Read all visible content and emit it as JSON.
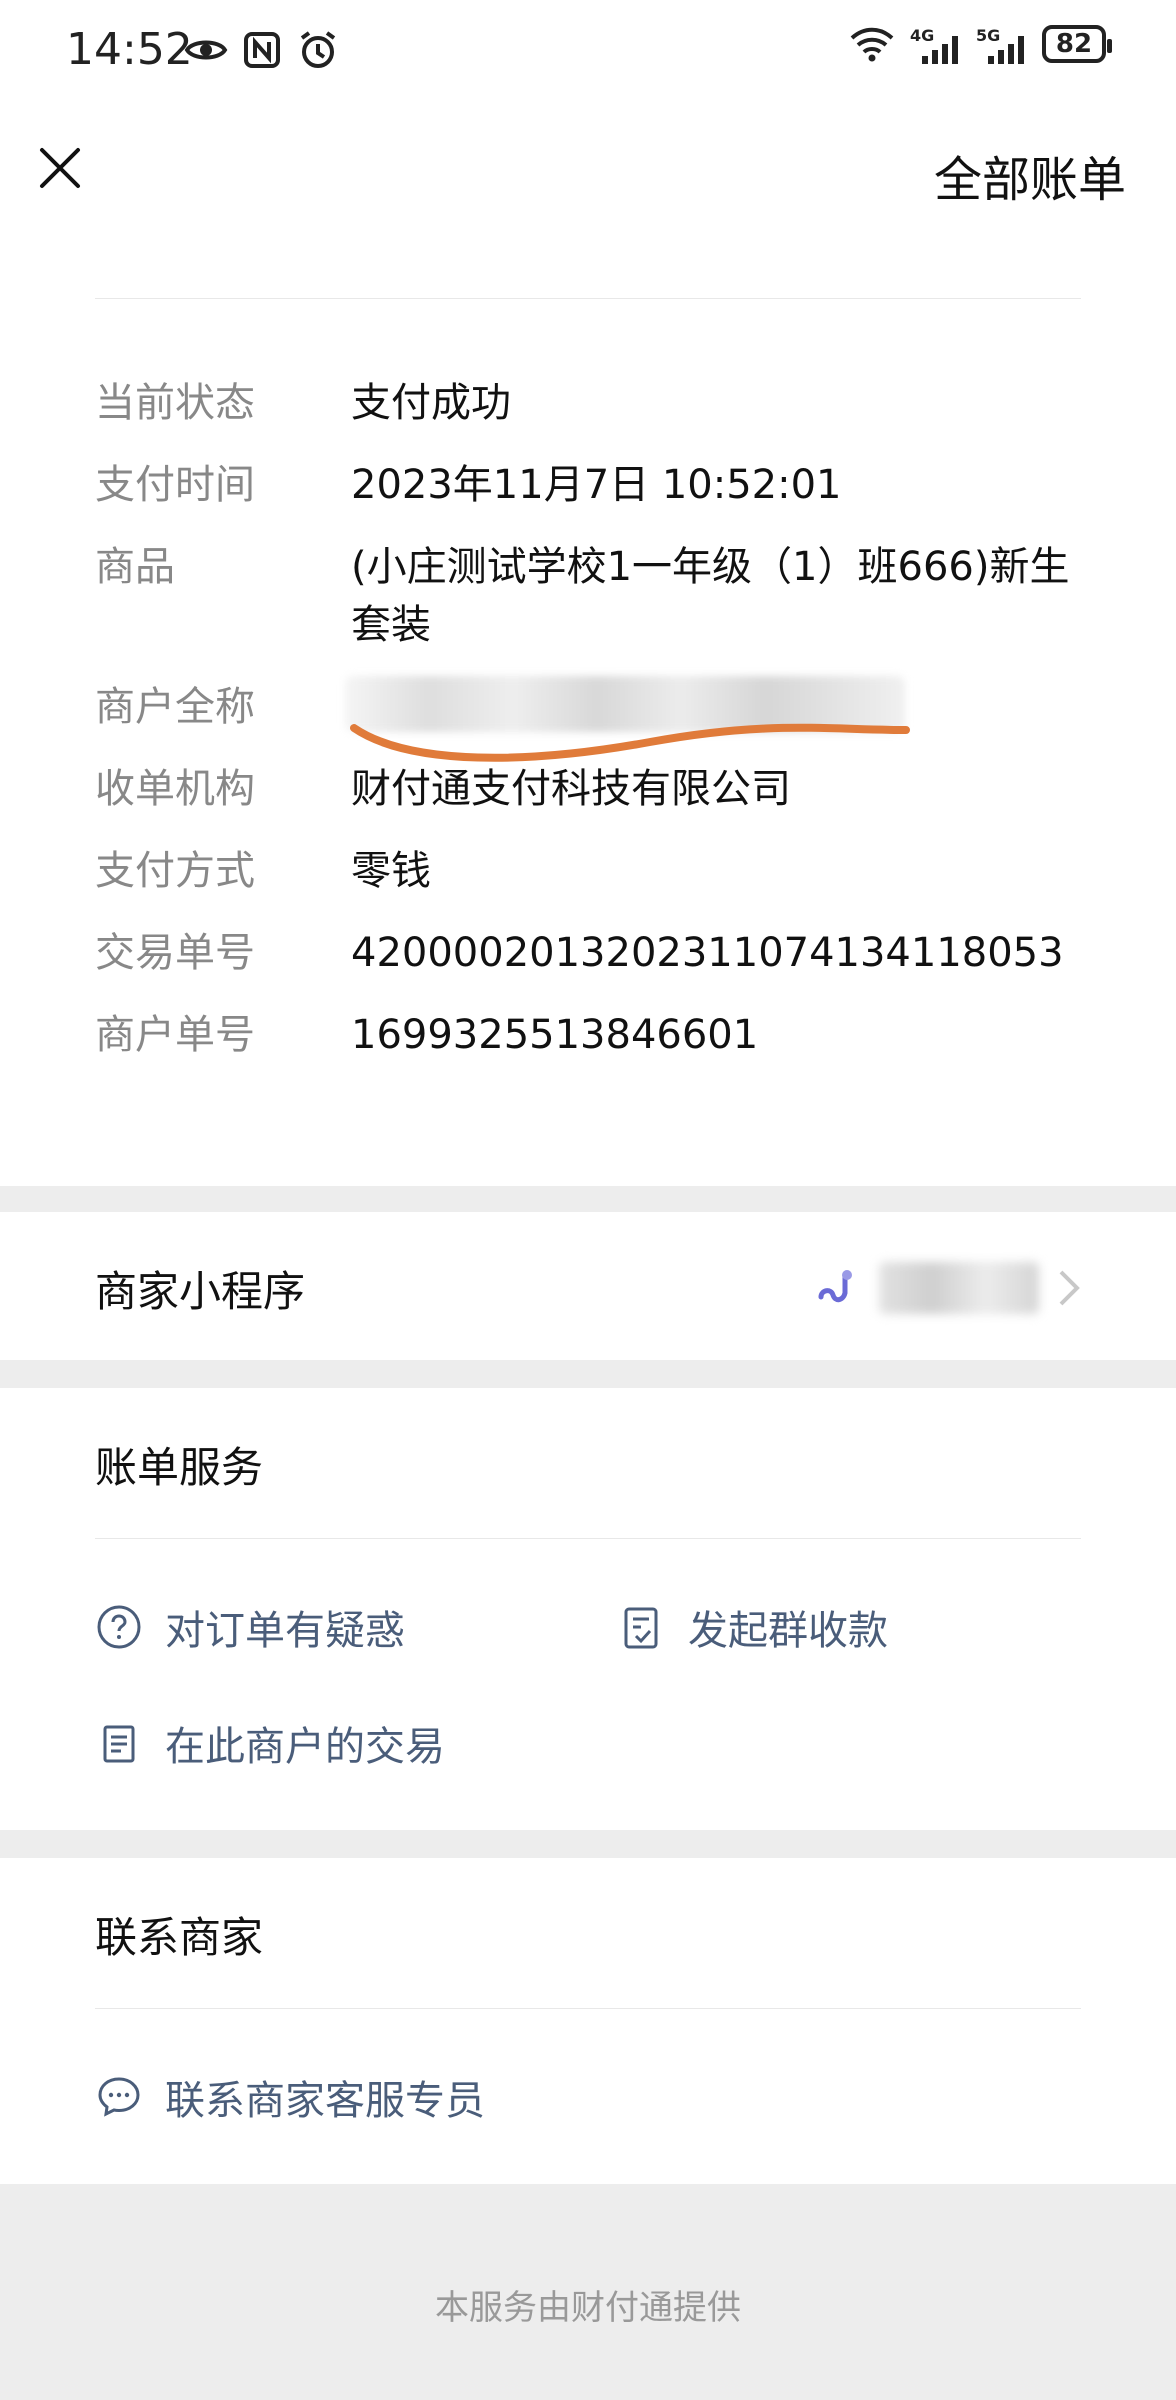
{
  "status_bar": {
    "time": "14:52",
    "battery": "82",
    "net1": "4G",
    "net2": "5G"
  },
  "header": {
    "link": "全部账单"
  },
  "details": [
    {
      "key": "当前状态",
      "value": "支付成功"
    },
    {
      "key": "支付时间",
      "value": "2023年11月7日 10:52:01"
    },
    {
      "key": "商品",
      "value": "(小庄测试学校1一年级（1）班666)新生套装"
    },
    {
      "key": "商户全称",
      "value": ""
    },
    {
      "key": "收单机构",
      "value": "财付通支付科技有限公司"
    },
    {
      "key": "支付方式",
      "value": "零钱"
    },
    {
      "key": "交易单号",
      "value": "4200002013202311074134118053"
    },
    {
      "key": "商户单号",
      "value": "1699325513846601"
    }
  ],
  "mini_program": {
    "title": "商家小程序"
  },
  "bill_service": {
    "title": "账单服务",
    "actions": {
      "question": "对订单有疑惑",
      "group": "发起群收款",
      "merchant": "在此商户的交易"
    }
  },
  "contact": {
    "title": "联系商家",
    "action": "联系商家客服专员"
  },
  "footer": "本服务由财付通提供",
  "colors": {
    "link": "#4a5d7a",
    "label": "#888888",
    "bg": "#ededed",
    "stroke": "#e07b3a"
  },
  "icons": [
    "close-icon",
    "question-icon",
    "group-bill-icon",
    "document-icon",
    "chat-icon",
    "chevron-right-icon",
    "mini-program-icon"
  ]
}
